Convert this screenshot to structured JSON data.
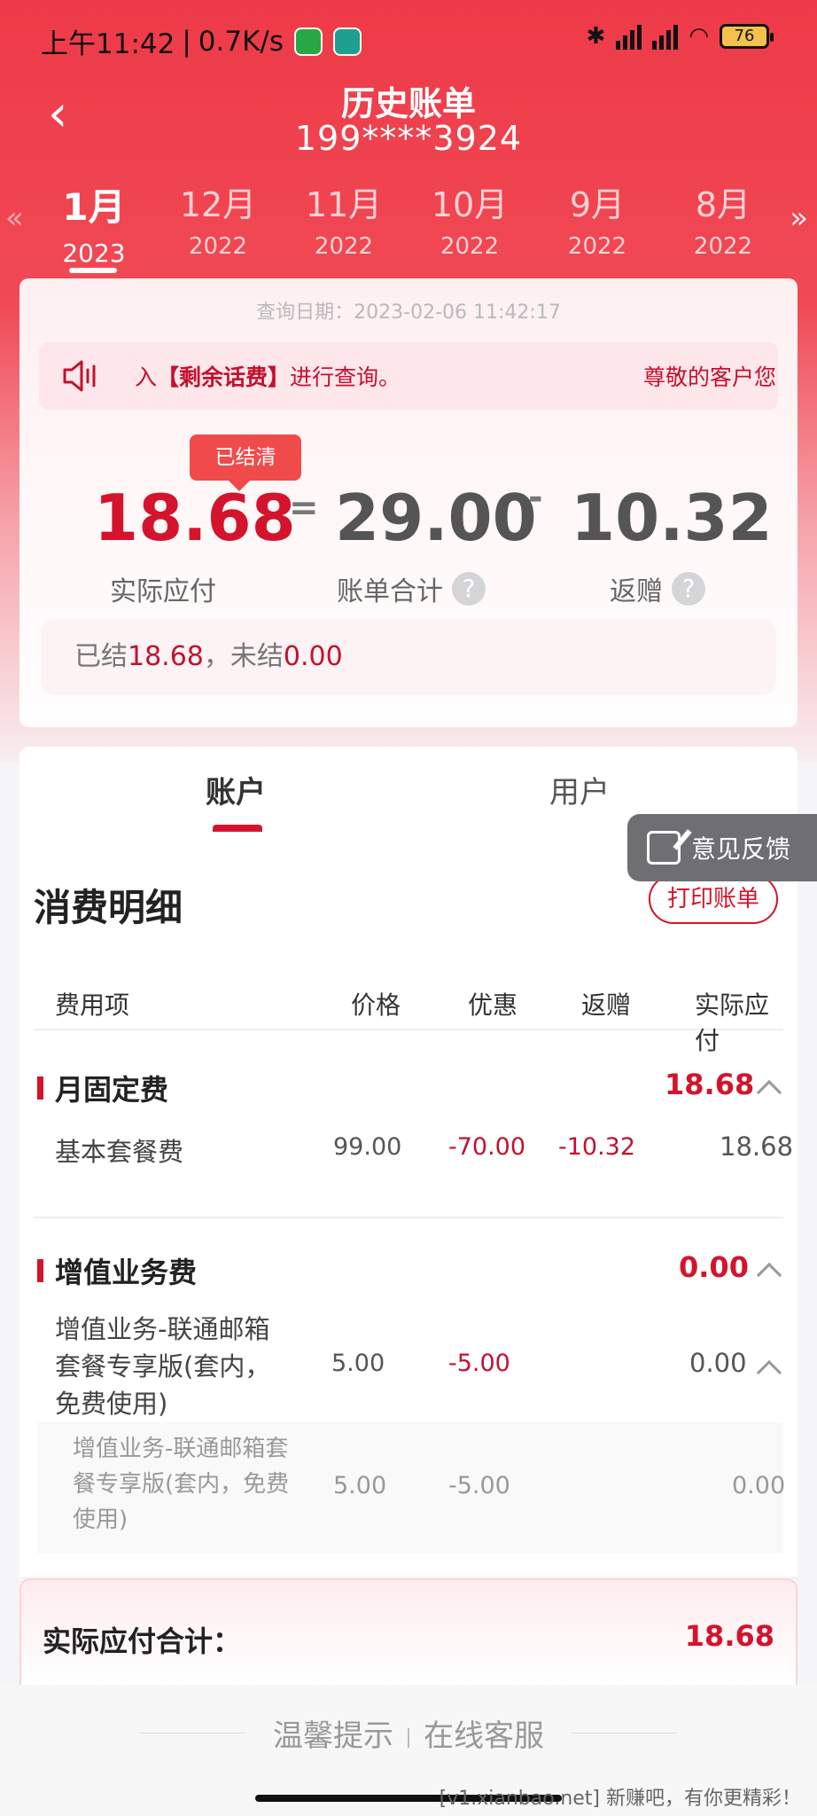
{
  "status_bar": {
    "time": "上午11:42",
    "speed": "0.7K/s",
    "battery": "76"
  },
  "header": {
    "title": "历史账单",
    "subtitle": "199****3924"
  },
  "months": [
    {
      "month": "1月",
      "year": "2023"
    },
    {
      "month": "12月",
      "year": "2022"
    },
    {
      "month": "11月",
      "year": "2022"
    },
    {
      "month": "10月",
      "year": "2022"
    },
    {
      "month": "9月",
      "year": "2022"
    },
    {
      "month": "8月",
      "year": "2022"
    }
  ],
  "summary": {
    "query_date": "查询日期：2023-02-06 11:42:17",
    "notice_lead": "入",
    "notice_bold": "【剩余话费】",
    "notice_tail": "进行查询。",
    "notice_right": "尊敬的客户您",
    "settled_tag": "已结清",
    "actual_due": "18.68",
    "bill_total": "29.00",
    "rebate": "10.32",
    "op_equal": "=",
    "op_minus": "-",
    "actual_due_label": "实际应付",
    "bill_total_label": "账单合计",
    "rebate_label": "返赠",
    "settled_prefix": "已结",
    "settled_amount": "18.68",
    "unsettled_prefix": "，未结",
    "unsettled_amount": "0.00"
  },
  "tabs": {
    "account": "账户",
    "user": "用户"
  },
  "feedback": "意见反馈",
  "detail": {
    "title": "消费明细",
    "print_button": "打印账单",
    "columns": [
      "费用项",
      "价格",
      "优惠",
      "返赠",
      "实际应付"
    ],
    "group1": {
      "name": "月固定费",
      "amount": "18.68",
      "row": {
        "item": "基本套餐费",
        "price": "99.00",
        "discount": "-70.00",
        "rebate": "-10.32",
        "due": "18.68"
      }
    },
    "group2": {
      "name": "增值业务费",
      "amount": "0.00",
      "row": {
        "item_l1": "增值业务-联通邮箱",
        "item_l2": "套餐专享版(套内，",
        "item_l3": "免费使用)",
        "price": "5.00",
        "discount": "-5.00",
        "due": "0.00"
      },
      "sub": {
        "item_l1": "增值业务-联通邮箱套",
        "item_l2": "餐专享版(套内，免费",
        "item_l3": "使用)",
        "price": "5.00",
        "discount": "-5.00",
        "due": "0.00"
      }
    }
  },
  "total": {
    "label": "实际应付合计：",
    "value": "18.68"
  },
  "footer": {
    "tips": "温馨提示",
    "service": "在线客服",
    "watermark": "[v1.xianbao.net] 新赚吧，有你更精彩！"
  },
  "colors": {
    "brand_red": "#d3142c",
    "header_red": "#ee3a48"
  }
}
